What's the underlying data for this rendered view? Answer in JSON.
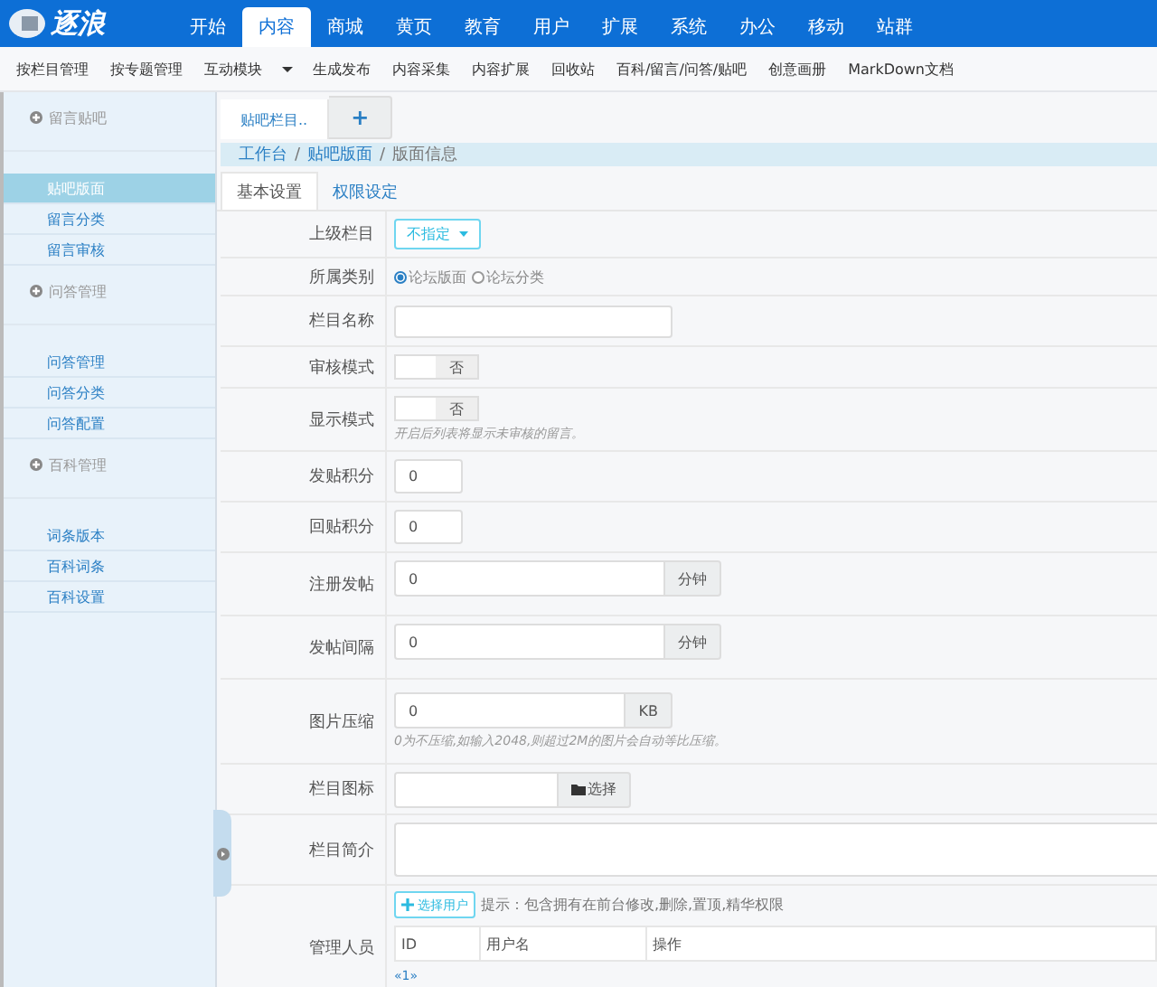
{
  "logo": {
    "text": "逐浪"
  },
  "nav": [
    {
      "label": "开始",
      "selected": false
    },
    {
      "label": "内容",
      "selected": true
    },
    {
      "label": "商城",
      "selected": false
    },
    {
      "label": "黄页",
      "selected": false
    },
    {
      "label": "教育",
      "selected": false
    },
    {
      "label": "用户",
      "selected": false
    },
    {
      "label": "扩展",
      "selected": false
    },
    {
      "label": "系统",
      "selected": false
    },
    {
      "label": "办公",
      "selected": false
    },
    {
      "label": "移动",
      "selected": false
    },
    {
      "label": "站群",
      "selected": false
    }
  ],
  "subnav": [
    {
      "label": "按栏目管理"
    },
    {
      "label": "按专题管理"
    },
    {
      "label": "互动模块",
      "dropdown": true
    },
    {
      "label": "生成发布"
    },
    {
      "label": "内容采集"
    },
    {
      "label": "内容扩展"
    },
    {
      "label": "回收站"
    },
    {
      "label": "百科/留言/问答/贴吧"
    },
    {
      "label": "创意画册"
    },
    {
      "label": "MarkDown文档"
    }
  ],
  "sidebar": [
    {
      "title": "留言贴吧",
      "items": [
        {
          "label": "贴吧版面",
          "selected": true
        },
        {
          "label": "留言分类",
          "selected": false
        },
        {
          "label": "留言审核",
          "selected": false
        }
      ]
    },
    {
      "title": "问答管理",
      "items": [
        {
          "label": "问答管理",
          "selected": false
        },
        {
          "label": "问答分类",
          "selected": false
        },
        {
          "label": "问答配置",
          "selected": false
        }
      ]
    },
    {
      "title": "百科管理",
      "items": [
        {
          "label": "词条版本",
          "selected": false
        },
        {
          "label": "百科词条",
          "selected": false
        },
        {
          "label": "百科设置",
          "selected": false
        }
      ]
    }
  ],
  "page_tabs": [
    {
      "label": "贴吧栏目..",
      "kind": "text"
    },
    {
      "label": "+",
      "kind": "add"
    }
  ],
  "breadcrumb": [
    {
      "kind": "link",
      "label": "工作台"
    },
    {
      "kind": "separator",
      "label": "/"
    },
    {
      "kind": "link",
      "label": "贴吧版面"
    },
    {
      "kind": "separator",
      "label": "/"
    },
    {
      "kind": "current",
      "label": "版面信息"
    }
  ],
  "form_tabs": [
    {
      "label": "基本设置",
      "selected": true
    },
    {
      "label": "权限设定",
      "selected": false
    }
  ],
  "form": [
    {
      "kind": "dropdown",
      "label": "上级栏目",
      "value": "不指定"
    },
    {
      "kind": "radio",
      "label": "所属类别",
      "options": [
        {
          "label": "论坛版面",
          "selected": true
        },
        {
          "label": "论坛分类",
          "selected": false
        }
      ]
    },
    {
      "kind": "text",
      "label": "栏目名称"
    },
    {
      "kind": "toggle",
      "label": "审核模式",
      "on": false,
      "state_text": "否"
    },
    {
      "kind": "toggle",
      "label": "显示模式",
      "on": false,
      "state_text": "否",
      "hint": "开启后列表将显示未审核的留言。"
    },
    {
      "kind": "number",
      "label": "发贴积分",
      "value": "0"
    },
    {
      "kind": "number",
      "label": "回贴积分",
      "value": "0"
    },
    {
      "kind": "addon",
      "label": "注册发帖",
      "value": "0",
      "unit": "分钟"
    },
    {
      "kind": "addon",
      "label": "发帖间隔",
      "value": "0",
      "unit": "分钟"
    },
    {
      "kind": "addon",
      "label": "图片压缩",
      "value": "0",
      "unit": "KB",
      "hint": "0为不压缩,如输入2048,则超过2M的图片会自动等比压缩。"
    },
    {
      "kind": "file",
      "label": "栏目图标",
      "button": "选择"
    },
    {
      "kind": "textarea",
      "label": "栏目简介"
    },
    {
      "kind": "users",
      "label": "管理人员",
      "button": "选择用户",
      "tip": "提示：包含拥有在前台修改,删除,置顶,精华权限",
      "columns": [
        "ID",
        "用户名",
        "操作"
      ],
      "pager": "«1»"
    }
  ]
}
